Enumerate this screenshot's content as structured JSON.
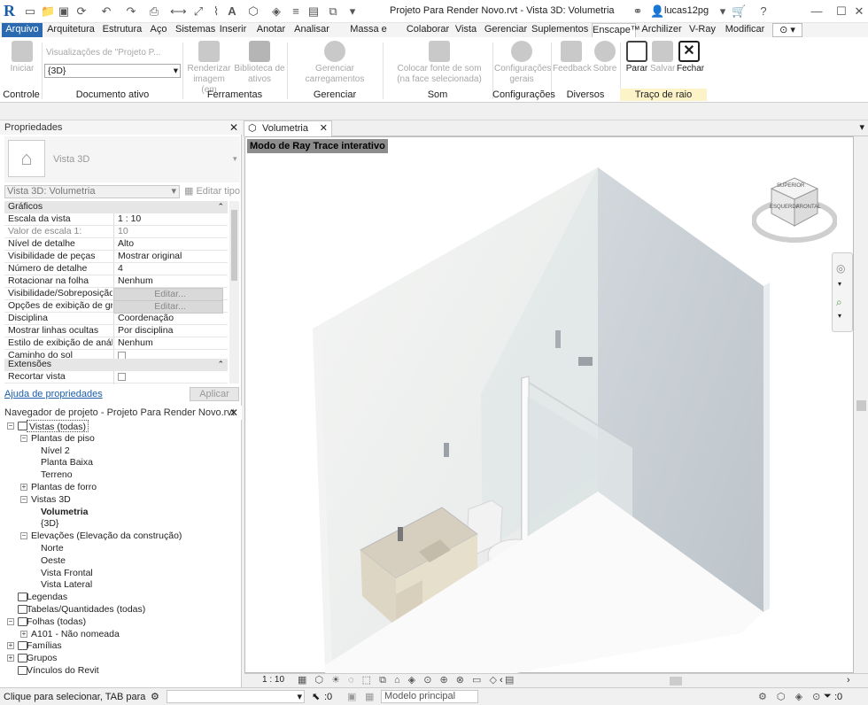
{
  "titlebar": {
    "app_logo": "R",
    "document_title": "Projeto Para Render Novo.rvt - Vista 3D: Volumetria",
    "user": "lucas12pg"
  },
  "ribbon_tabs": [
    "Arquivo",
    "Arquitetura",
    "Estrutura",
    "Aço",
    "Sistemas",
    "Inserir",
    "Anotar",
    "Analisar",
    "Massa e terreno",
    "Colaborar",
    "Vista",
    "Gerenciar",
    "Suplementos",
    "Enscape™",
    "Archilizer",
    "V-Ray",
    "Modificar"
  ],
  "ribbon": {
    "iniciar": "Iniciar",
    "views_placeholder": "Visualizações de \"Projeto P...",
    "views_value": "{3D}",
    "renderizar": "Renderizar imagem (em",
    "biblioteca": "Biblioteca de ativos",
    "gerenciar_carreg": "Gerenciar carregamentos",
    "colocar_fonte": "Colocar fonte de som (na face selecionada)",
    "config_gerais": "Configurações gerais",
    "feedback": "Feedback",
    "sobre": "Sobre",
    "parar": "Parar",
    "salvar": "Salvar",
    "fechar": "Fechar",
    "panels": [
      "Controle",
      "Documento ativo",
      "Ferramentas",
      "Gerenciar carregamentos",
      "Som",
      "Configurações",
      "Diversos",
      "Traço de raio interativo"
    ]
  },
  "properties": {
    "title": "Propriedades",
    "type_name": "Vista 3D",
    "view_selector": "Vista 3D: Volumetria",
    "edit_type": "Editar tipo",
    "group_graphics": "Gráficos",
    "group_extents": "Extensões",
    "rows": [
      {
        "k": "Escala da vista",
        "v": "1 : 10"
      },
      {
        "k": "Valor de escala    1:",
        "v": "10"
      },
      {
        "k": "Nível de detalhe",
        "v": "Alto"
      },
      {
        "k": "Visibilidade de peças",
        "v": "Mostrar original"
      },
      {
        "k": "Número de detalhe",
        "v": "4"
      },
      {
        "k": "Rotacionar na folha",
        "v": "Nenhum"
      },
      {
        "k": "Visibilidade/Sobreposição ...",
        "v": "Editar..."
      },
      {
        "k": "Opções de exibição de grá...",
        "v": "Editar..."
      },
      {
        "k": "Disciplina",
        "v": "Coordenação"
      },
      {
        "k": "Mostrar linhas ocultas",
        "v": "Por disciplina"
      },
      {
        "k": "Estilo de exibição de anális...",
        "v": "Nenhum"
      },
      {
        "k": "Caminho do sol",
        "v": ""
      }
    ],
    "crop_row": "Recortar vista",
    "help_link": "Ajuda de propriedades",
    "apply": "Aplicar"
  },
  "navigator": {
    "title": "Navegador de projeto - Projeto Para Render Novo.rvt",
    "nodes": [
      {
        "label": "Vistas (todas)",
        "level": 0
      },
      {
        "label": "Plantas de piso",
        "level": 1
      },
      {
        "label": "Nível 2",
        "level": 2
      },
      {
        "label": "Planta Baixa",
        "level": 2
      },
      {
        "label": "Terreno",
        "level": 2
      },
      {
        "label": "Plantas de forro",
        "level": 1
      },
      {
        "label": "Vistas 3D",
        "level": 1
      },
      {
        "label": "Volumetria",
        "level": 2
      },
      {
        "label": "{3D}",
        "level": 2
      },
      {
        "label": "Elevações (Elevação da construção)",
        "level": 1
      },
      {
        "label": "Norte",
        "level": 2
      },
      {
        "label": "Oeste",
        "level": 2
      },
      {
        "label": "Vista Frontal",
        "level": 2
      },
      {
        "label": "Vista Lateral",
        "level": 2
      },
      {
        "label": "Legendas",
        "level": 0
      },
      {
        "label": "Tabelas/Quantidades (todas)",
        "level": 0
      },
      {
        "label": "Folhas (todas)",
        "level": 0
      },
      {
        "label": "A101 - Não nomeada",
        "level": 1
      },
      {
        "label": "Famílias",
        "level": 0
      },
      {
        "label": "Grupos",
        "level": 0
      },
      {
        "label": "Vínculos do Revit",
        "level": 0
      }
    ]
  },
  "view": {
    "tab": "Volumetria",
    "raytrace_label": "Modo de Ray Trace interativo",
    "cube_top": "SUPERIOR",
    "cube_front": "FRONTAL",
    "cube_left": "ESQUERDA",
    "scale": "1 : 10"
  },
  "status": {
    "hint": "Clique para selecionar, TAB para alternat",
    "sel_count": ":0",
    "model": "Modelo principal",
    "filter_count": ":0"
  }
}
